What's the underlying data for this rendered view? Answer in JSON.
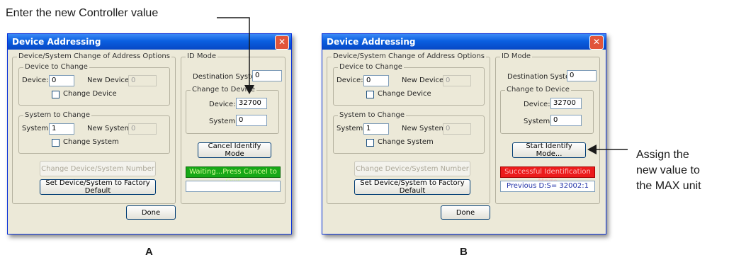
{
  "annotations": {
    "top_note": "Enter the new Controller value",
    "side_note_line1": "Assign the",
    "side_note_line2": "new value to",
    "side_note_line3": "the MAX unit",
    "caption_a": "A",
    "caption_b": "B"
  },
  "dialog_a": {
    "title": "Device Addressing",
    "close_glyph": "✕",
    "change_group_title": "Device/System Change of Address Options",
    "device_group_title": "Device to Change",
    "device_label": "Device:",
    "device_value": "0",
    "new_device_label": "New Device:",
    "new_device_value": "0",
    "change_device_label": "Change Device",
    "system_group_title": "System to Change",
    "system_label": "System:",
    "system_value": "1",
    "new_system_label": "New System:",
    "new_system_value": "0",
    "change_system_label": "Change System",
    "change_number_button": "Change Device/System Number",
    "factory_default_button": "Set Device/System to Factory Default",
    "done_button": "Done",
    "id_mode_title": "ID Mode",
    "destination_label": "Destination System:",
    "destination_value": "0",
    "change_to_device_title": "Change to Device",
    "id_device_label": "Device:",
    "id_device_value": "32700",
    "id_system_label": "System:",
    "id_system_value": "0",
    "identify_button": "Cancel Identify Mode",
    "status_text": "Waiting...Press Cancel to Quit",
    "status_color": "#17a817",
    "info_text": ""
  },
  "dialog_b": {
    "title": "Device Addressing",
    "close_glyph": "✕",
    "change_group_title": "Device/System Change of Address Options",
    "device_group_title": "Device to Change",
    "device_label": "Device:",
    "device_value": "0",
    "new_device_label": "New Device:",
    "new_device_value": "0",
    "change_device_label": "Change Device",
    "system_group_title": "System to Change",
    "system_label": "System:",
    "system_value": "1",
    "new_system_label": "New System:",
    "new_system_value": "0",
    "change_system_label": "Change System",
    "change_number_button": "Change Device/System Number",
    "factory_default_button": "Set Device/System to Factory Default",
    "done_button": "Done",
    "id_mode_title": "ID Mode",
    "destination_label": "Destination System:",
    "destination_value": "0",
    "change_to_device_title": "Change to Device",
    "id_device_label": "Device:",
    "id_device_value": "32700",
    "id_system_label": "System:",
    "id_system_value": "0",
    "identify_button": "Start Identify Mode...",
    "status_text": "Successful Identification Mode",
    "status_color": "#ec1b1b",
    "info_text": "Previous D:S= 32002:1"
  }
}
